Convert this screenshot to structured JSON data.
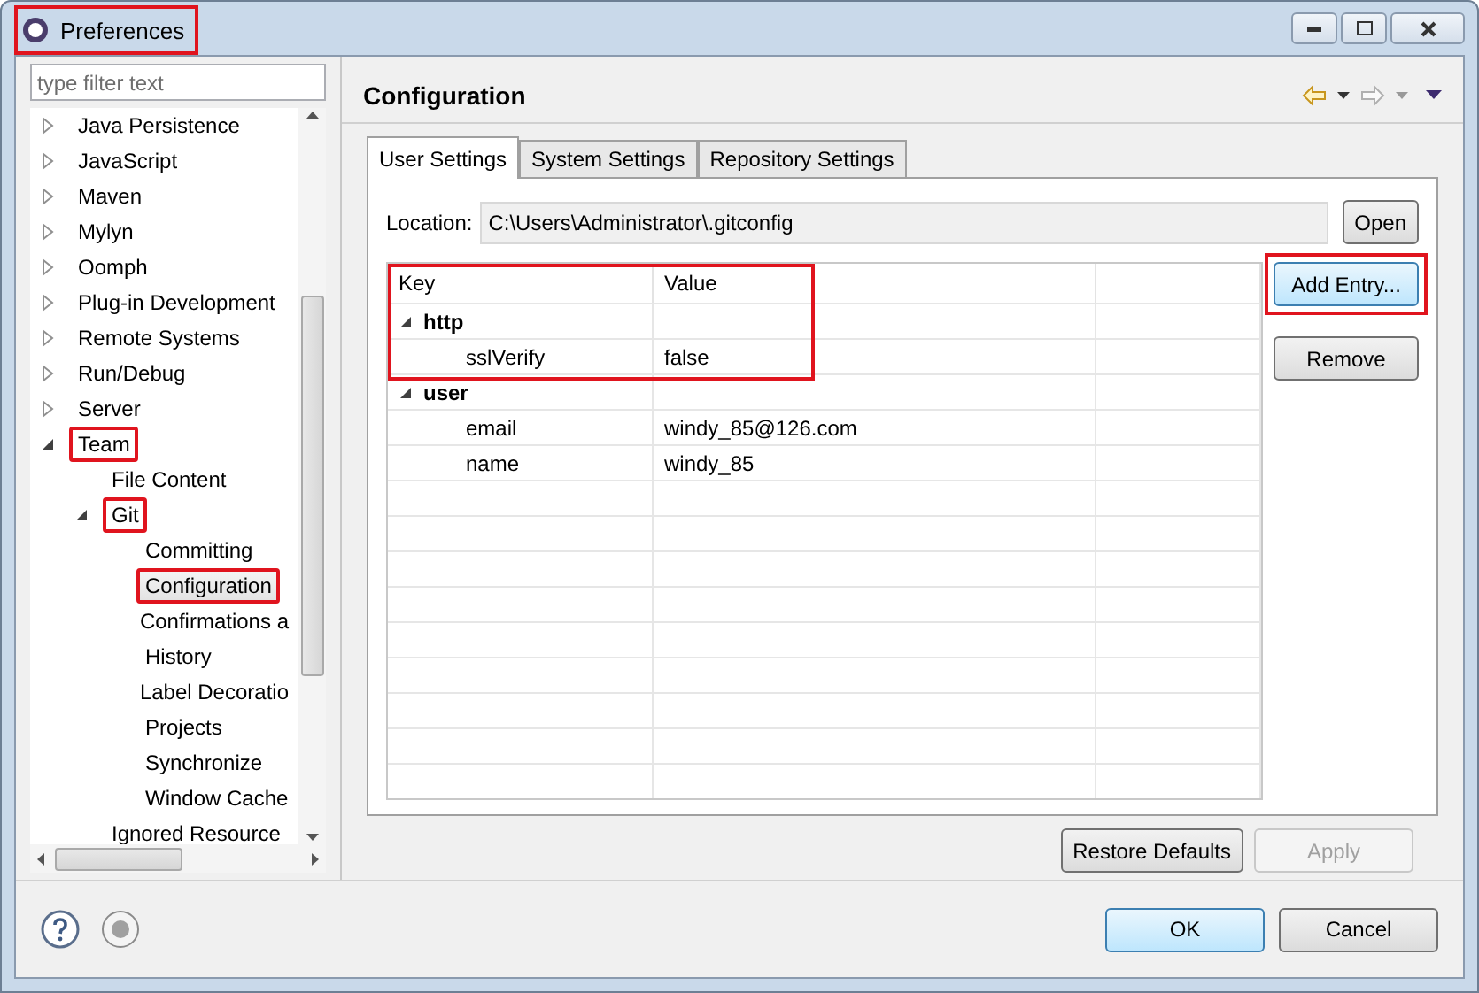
{
  "window": {
    "title": "Preferences",
    "annotated": true
  },
  "filter": {
    "placeholder": "type filter text"
  },
  "tree": [
    {
      "label": "Java Persistence",
      "expanded": false
    },
    {
      "label": "JavaScript",
      "expanded": false
    },
    {
      "label": "Maven",
      "expanded": false
    },
    {
      "label": "Mylyn",
      "expanded": false
    },
    {
      "label": "Oomph",
      "expanded": false
    },
    {
      "label": "Plug-in Development",
      "expanded": false
    },
    {
      "label": "Remote Systems",
      "expanded": false
    },
    {
      "label": "Run/Debug",
      "expanded": false
    },
    {
      "label": "Server",
      "expanded": false
    },
    {
      "label": "Team",
      "expanded": true,
      "annotated": true,
      "children": [
        {
          "label": "File Content"
        },
        {
          "label": "Git",
          "expanded": true,
          "annotated": true,
          "children": [
            {
              "label": "Committing",
              "selected": false
            },
            {
              "label": "Configuration",
              "selected": true,
              "annotated": true
            },
            {
              "label": "Confirmations a",
              "selected": false
            },
            {
              "label": "History",
              "selected": false
            },
            {
              "label": "Label Decoratio",
              "selected": false
            },
            {
              "label": "Projects",
              "selected": false
            },
            {
              "label": "Synchronize",
              "selected": false
            },
            {
              "label": "Window Cache",
              "selected": false
            }
          ]
        },
        {
          "label": "Ignored Resource"
        }
      ]
    }
  ],
  "page": {
    "title": "Configuration"
  },
  "tabs": [
    {
      "label": "User Settings",
      "selected": true
    },
    {
      "label": "System Settings",
      "selected": false
    },
    {
      "label": "Repository Settings",
      "selected": false
    }
  ],
  "location": {
    "label": "Location:",
    "value": "C:\\Users\\Administrator\\.gitconfig",
    "button": "Open"
  },
  "table": {
    "columns": [
      "Key",
      "Value"
    ],
    "annotated": true,
    "rows": [
      {
        "kind": "group",
        "key": "http",
        "expanded": true
      },
      {
        "kind": "entry",
        "key": "sslVerify",
        "value": "false"
      },
      {
        "kind": "group",
        "key": "user",
        "expanded": true
      },
      {
        "kind": "entry",
        "key": "email",
        "value": "windy_85@126.com"
      },
      {
        "kind": "entry",
        "key": "name",
        "value": "windy_85"
      }
    ]
  },
  "side_buttons": [
    {
      "label": "Add Entry...",
      "annotated": true,
      "focused": true
    },
    {
      "label": "Remove",
      "annotated": false,
      "focused": false
    }
  ],
  "page_buttons": [
    {
      "label": "Restore Defaults",
      "disabled": false
    },
    {
      "label": "Apply",
      "disabled": true
    }
  ],
  "dialog_buttons": [
    {
      "label": "OK",
      "default": true
    },
    {
      "label": "Cancel",
      "default": false
    }
  ]
}
